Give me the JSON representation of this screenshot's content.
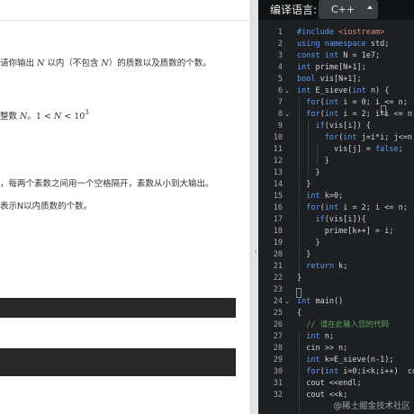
{
  "problem": {
    "line1": {
      "prefix": "请你输出 ",
      "var1": "N",
      "mid": " 以内（不包含 ",
      "var2": "N",
      "suffix": "）的质数以及质数的个数。"
    },
    "line2": {
      "prefix": "整数 ",
      "var": "N",
      "sep": "。",
      "lower": "1",
      "lt1": " < ",
      "mid": "N",
      "lt2": " < ",
      "base": "10",
      "exp": "3"
    },
    "line3": "，每两个素数之间用一个空格隔开，素数从小到大输出。",
    "line4": "表示N以内质数的个数。"
  },
  "editor": {
    "lang_label": "编译语言:",
    "lang_value": "C++",
    "line_numbers": [
      "1",
      "2",
      "3",
      "4",
      "5",
      "6",
      "7",
      "8",
      "9",
      "10",
      "11",
      "12",
      "13",
      "14",
      "15",
      "16",
      "17",
      "18",
      "19",
      "20",
      "21",
      "22",
      "23",
      "24",
      "25",
      "26",
      "27",
      "28",
      "29",
      "30",
      "31",
      "32"
    ],
    "watermark": "@稀土掘金技术社区"
  }
}
